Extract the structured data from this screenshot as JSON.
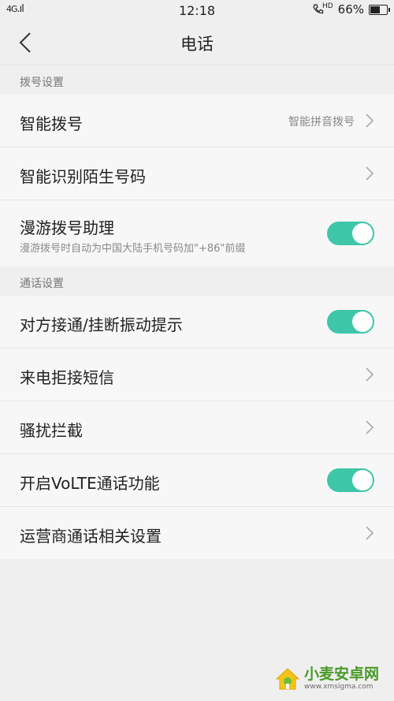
{
  "status_bar": {
    "network": "4G",
    "time": "12:18",
    "hd_label": "HD",
    "battery": "66%",
    "battery_level": 0.66
  },
  "header": {
    "title": "电话"
  },
  "sections": [
    {
      "title": "拨号设置",
      "rows": [
        {
          "label": "智能拨号",
          "value": "智能拼音拨号",
          "control": "chevron"
        },
        {
          "label": "智能识别陌生号码",
          "control": "chevron"
        },
        {
          "label": "漫游拨号助理",
          "sub": "漫游拨号时自动为中国大陆手机号码加\"+86\"前缀",
          "control": "toggle",
          "on": true
        }
      ]
    },
    {
      "title": "通话设置",
      "rows": [
        {
          "label": "对方接通/挂断振动提示",
          "control": "toggle",
          "on": true
        },
        {
          "label": "来电拒接短信",
          "control": "chevron"
        },
        {
          "label": "骚扰拦截",
          "control": "chevron"
        },
        {
          "label": "开启VoLTE通话功能",
          "control": "toggle",
          "on": true
        },
        {
          "label": "运营商通话相关设置",
          "control": "chevron"
        }
      ]
    }
  ],
  "watermark": {
    "name": "小麦安卓网",
    "url": "www.xmsigma.com"
  },
  "colors": {
    "accent": "#3ec6a8",
    "background": "#efefef",
    "row_bg": "#f7f7f7"
  }
}
